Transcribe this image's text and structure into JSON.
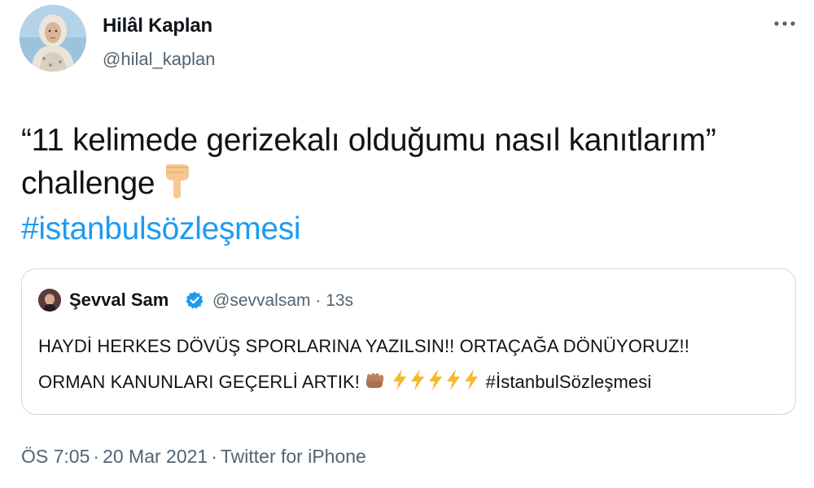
{
  "author": {
    "name": "Hilâl Kaplan",
    "handle": "@hilal_kaplan",
    "avatar_icon": "profile-photo"
  },
  "more_icon": "more-horizontal-icon",
  "tweet": {
    "line1": "“11 kelimede gerizekalı olduğumu nasıl kanıtlarım”",
    "line2": "challenge",
    "emoji": "backhand-index-pointing-down",
    "hashtag": "#istanbulsözleşmesi"
  },
  "quoted": {
    "name": "Şevval Sam",
    "verified_icon": "verified-badge-icon",
    "handle": "@sevvalsam",
    "separator": "·",
    "time": "13s",
    "line1": "HAYDİ HERKES DÖVÜŞ SPORLARINA YAZILSIN!! ORTAÇAĞA DÖNÜYORUZ!!",
    "line2_text": "ORMAN KANUNLARI GEÇERLİ ARTIK!",
    "line2_emojis": [
      "oncoming-fist",
      "high-voltage",
      "high-voltage",
      "high-voltage",
      "high-voltage",
      "high-voltage"
    ],
    "hashtag": "#İstanbulSözleşmesi"
  },
  "footer": {
    "time": "ÖS 7:05",
    "separator": "·",
    "date": "20 Mar 2021",
    "source": "Twitter for iPhone"
  },
  "colors": {
    "link": "#1d9bf0",
    "secondary_text": "#536471",
    "border": "#cfd9de",
    "verified": "#1d9bf0",
    "lightning": "#f7b928"
  }
}
